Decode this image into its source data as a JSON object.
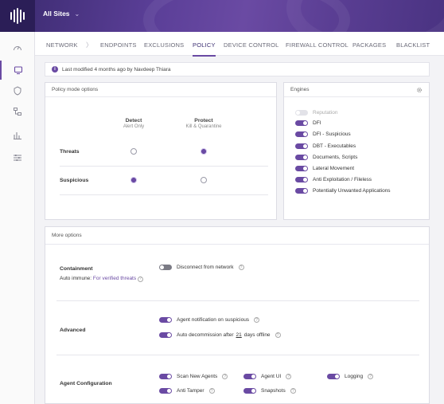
{
  "topbar": {
    "site": "All Sites"
  },
  "tabs": [
    "NETWORK",
    "ENDPOINTS",
    "EXCLUSIONS",
    "POLICY",
    "DEVICE CONTROL",
    "FIREWALL CONTROL",
    "PACKAGES",
    "BLACKLIST"
  ],
  "info": {
    "text": "Last modified 4 months ago by Navdeep Thiara"
  },
  "policy": {
    "title": "Policy mode options",
    "detect": {
      "label": "Detect",
      "sub": "Alert Only"
    },
    "protect": {
      "label": "Protect",
      "sub": "Kill & Quarantine"
    },
    "rows": [
      {
        "label": "Threats",
        "selected": "protect"
      },
      {
        "label": "Suspicious",
        "selected": "detect"
      }
    ]
  },
  "engines": {
    "title": "Engines",
    "items": [
      {
        "label": "Reputation",
        "enabled": false
      },
      {
        "label": "DFI",
        "enabled": true
      },
      {
        "label": "DFI - Suspicious",
        "enabled": true
      },
      {
        "label": "DBT - Executables",
        "enabled": true
      },
      {
        "label": "Documents, Scripts",
        "enabled": true
      },
      {
        "label": "Lateral Movement",
        "enabled": true
      },
      {
        "label": "Anti Exploitation / Fileless",
        "enabled": true
      },
      {
        "label": "Potentially Unwanted Applications",
        "enabled": true
      }
    ]
  },
  "more": {
    "title": "More options",
    "containment": {
      "label": "Containment",
      "auto_immune_label": "Auto immune:",
      "auto_immune_value": "For verified threats",
      "disconnect": "Disconnect from network"
    },
    "advanced": {
      "label": "Advanced",
      "notify": "Agent notification on suspicious",
      "decom_prefix": "Auto decommission after",
      "decom_days": "21",
      "decom_suffix": "days offline"
    },
    "agent": {
      "label": "Agent Configuration",
      "scan": "Scan New Agents",
      "ui": "Agent UI",
      "logging": "Logging",
      "tamper": "Anti Tamper",
      "snapshots": "Snapshots"
    }
  },
  "help_glyph": "?",
  "info_glyph": "i",
  "colors": {
    "accent": "#6a4aa3",
    "topbar": "#5b3f98"
  }
}
